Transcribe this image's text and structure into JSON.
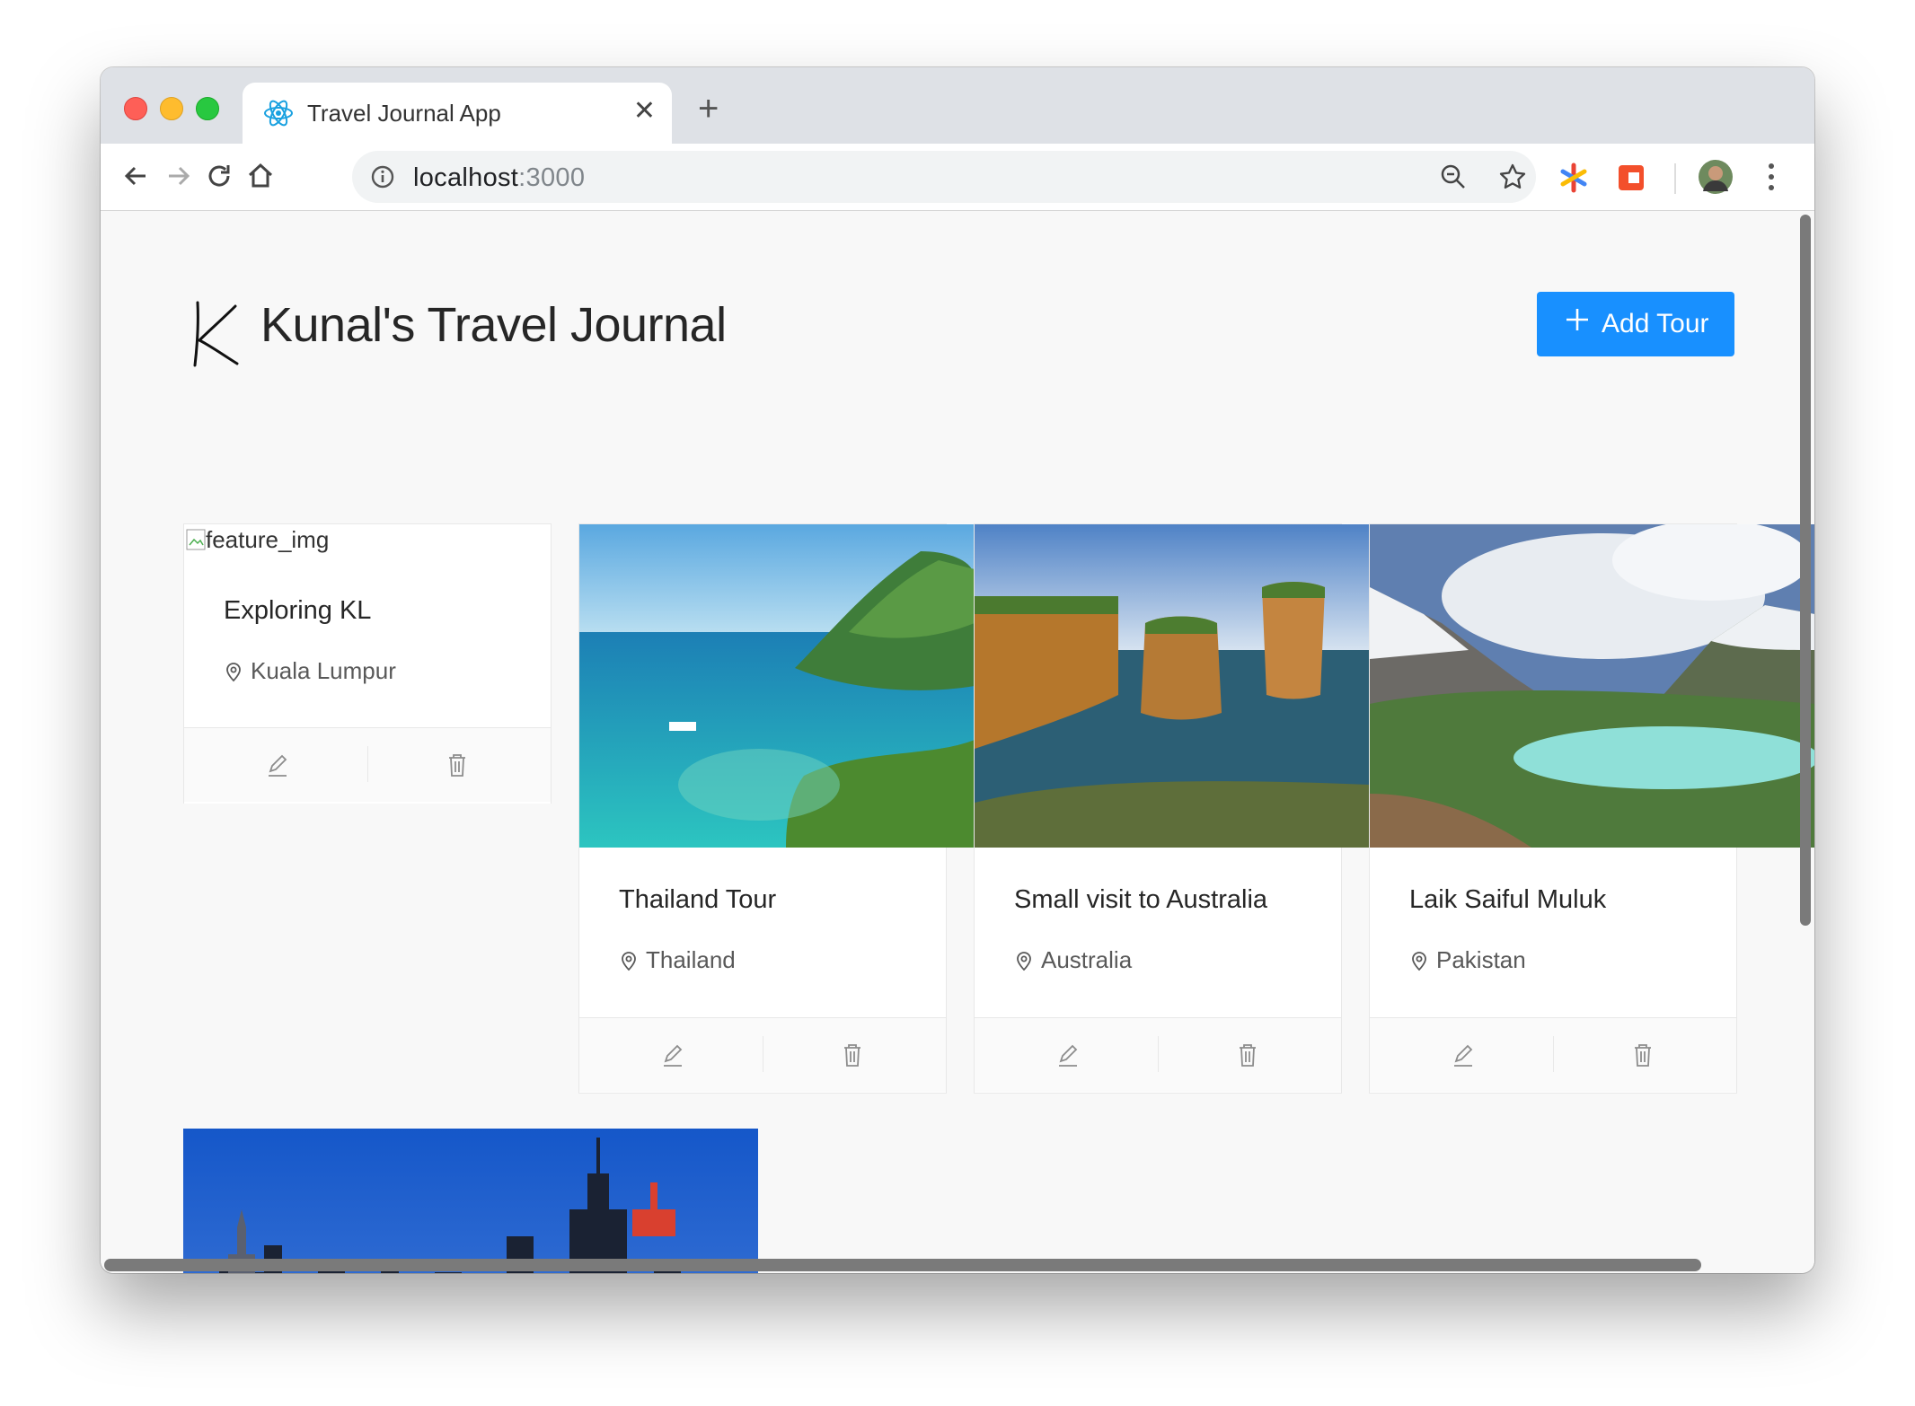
{
  "browser": {
    "tab_title": "Travel Journal App",
    "tab_close": "✕",
    "new_tab": "+",
    "url_host": "localhost",
    "url_port": ":3000"
  },
  "header": {
    "title": "Kunal's Travel Journal",
    "add_button": "Add Tour",
    "accent": "#1890ff"
  },
  "tours": [
    {
      "title": "Exploring KL",
      "location": "Kuala Lumpur",
      "image_alt": "feature_img",
      "image": "broken"
    },
    {
      "title": "Thailand Tour",
      "location": "Thailand",
      "image": "tropical-island"
    },
    {
      "title": "Small visit to Australia",
      "location": "Australia",
      "image": "sea-cliffs"
    },
    {
      "title": "Laik Saiful Muluk",
      "location": "Pakistan",
      "image": "mountain-lake"
    },
    {
      "title": "",
      "location": "",
      "image": "city-skyline-night"
    }
  ],
  "icons": {
    "edit": "edit-icon",
    "delete": "delete-icon",
    "location": "location-pin-icon"
  }
}
